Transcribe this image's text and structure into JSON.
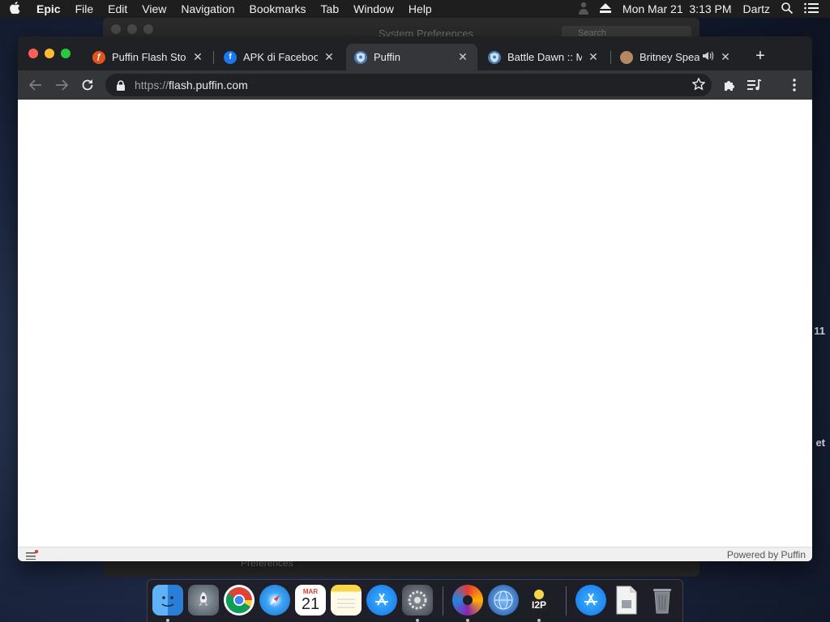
{
  "menubar": {
    "app_name": "Epic",
    "items": [
      "File",
      "Edit",
      "View",
      "Navigation",
      "Bookmarks",
      "Tab",
      "Window",
      "Help"
    ],
    "datetime": "Mon Mar 21  3:13 PM",
    "user": "Dartz",
    "icons": [
      "apple-icon",
      "user-silhouette-icon",
      "eject-icon",
      "spotlight-search-icon",
      "notification-list-icon"
    ]
  },
  "background_window": {
    "title": "System Preferences",
    "search_placeholder": "Search",
    "footer_text": "Preferences",
    "side_text_1": "11",
    "side_text_2": "et"
  },
  "browser": {
    "tabs": [
      {
        "label": "Puffin Flash Store",
        "favicon": "flash-icon",
        "color": "#e2541d",
        "active": false
      },
      {
        "label": "APK di Facebook",
        "favicon": "facebook-icon",
        "color": "#1877f2",
        "active": false
      },
      {
        "label": "Puffin",
        "favicon": "puffin-shield-icon",
        "color": "#4a7fb5",
        "active": true
      },
      {
        "label": "Battle Dawn :: Ma",
        "favicon": "puffin-shield-icon",
        "color": "#4a7fb5",
        "active": false
      },
      {
        "label": "Britney Spear",
        "favicon": "britney-avatar-icon",
        "color": "#b58863",
        "active": false,
        "audio": true
      }
    ],
    "address": {
      "scheme": "https://",
      "host": "flash.puffin.com"
    },
    "status": {
      "powered_by": "Powered by Puffin"
    }
  },
  "dock": {
    "calendar": {
      "month": "MAR",
      "day": "21"
    },
    "apps": [
      "Finder",
      "Launchpad",
      "Chrome",
      "Safari",
      "Calendar",
      "Notes",
      "App Store",
      "System Preferences",
      "Epic",
      "Network Utility",
      "I2P",
      "App Store Downloads",
      "Document",
      "Trash"
    ],
    "i2p_label": "I2P"
  },
  "colors": {
    "menubar": "#1e1e1e",
    "tabstrip": "#202124",
    "toolbar": "#35363a",
    "close_red": "#ff5f57",
    "minimize_yellow": "#febc2e",
    "zoom_green": "#28c840"
  }
}
